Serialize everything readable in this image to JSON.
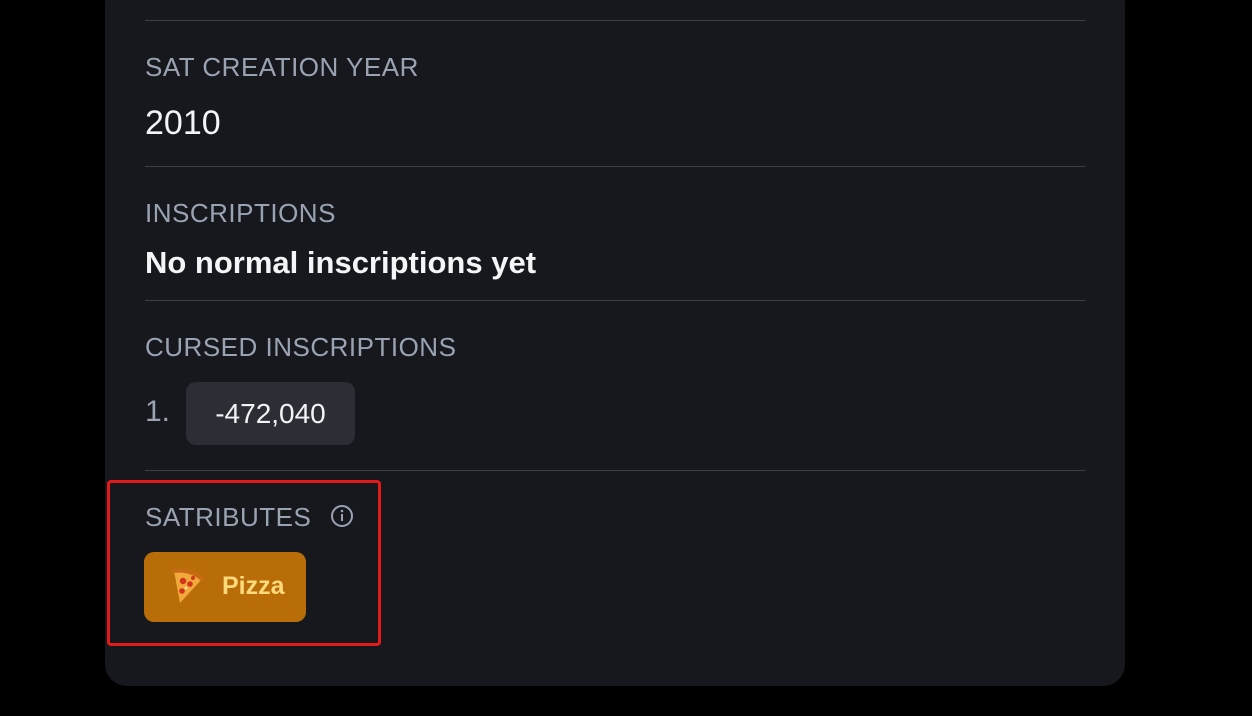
{
  "sections": {
    "sat_creation_year": {
      "label": "SAT CREATION YEAR",
      "value": "2010"
    },
    "inscriptions": {
      "label": "INSCRIPTIONS",
      "value": "No normal inscriptions yet"
    },
    "cursed_inscriptions": {
      "label": "CURSED INSCRIPTIONS",
      "items": [
        {
          "index": "1.",
          "value": "-472,040"
        }
      ]
    },
    "satributes": {
      "label": "SATRIBUTES",
      "info_icon": "info-circle-icon",
      "badges": [
        {
          "icon": "pizza-icon",
          "label": "Pizza",
          "color": "#b96d08"
        }
      ]
    }
  },
  "colors": {
    "page_background": "#000000",
    "card_background": "#16181d",
    "label": "#9aa3b2",
    "value": "#f4f5f7",
    "divider": "#3b4048",
    "chip_background": "#2b2f35",
    "highlight_border": "#e21a1a",
    "badge_text": "#ffd97a"
  }
}
